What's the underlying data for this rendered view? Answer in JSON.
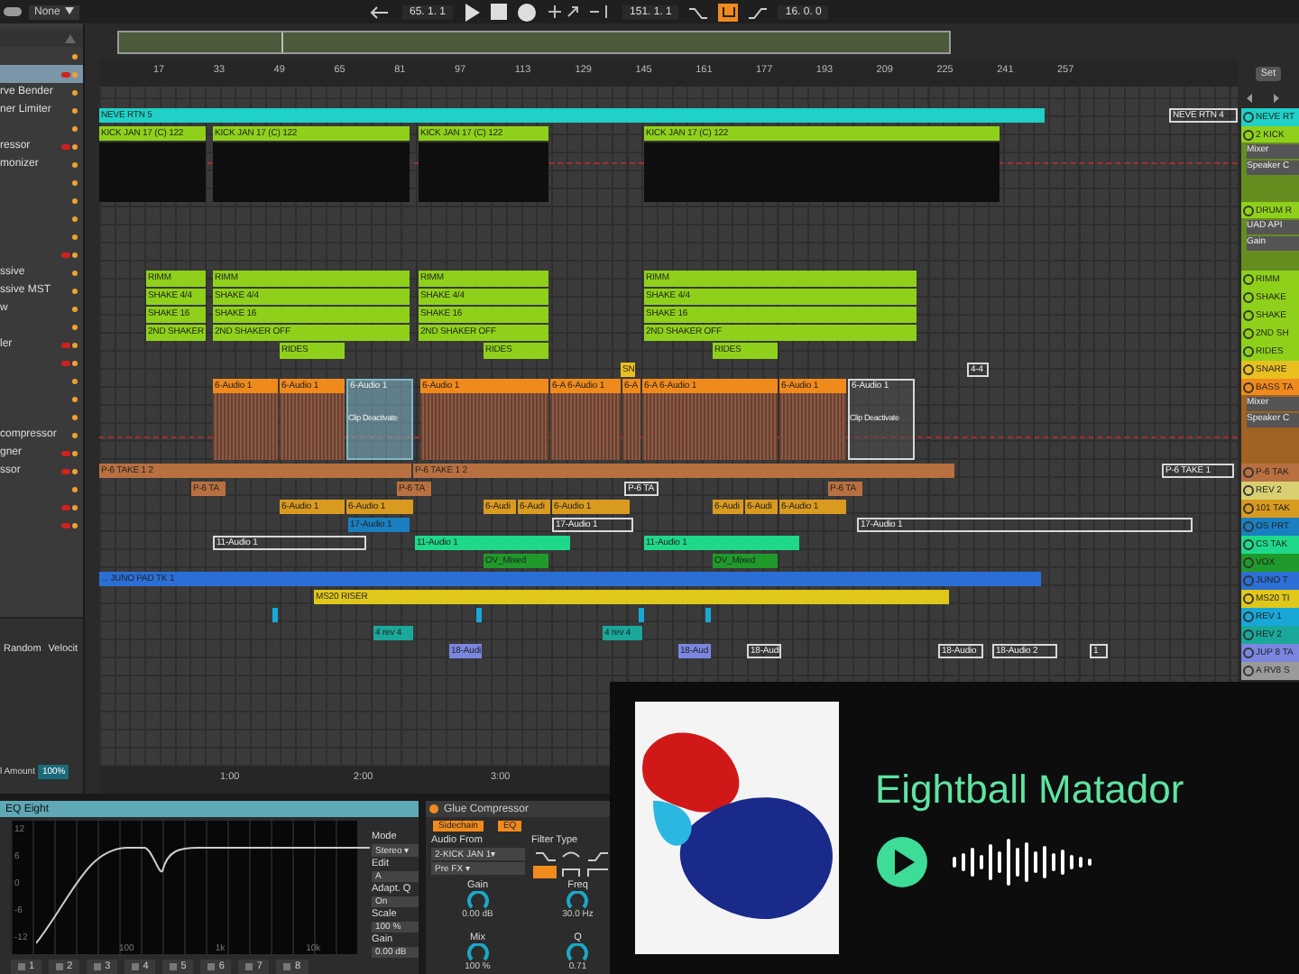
{
  "toolbar": {
    "dropdown": "None",
    "position": "65. 1. 1",
    "loop_start": "151. 1. 1",
    "loop_length": "16. 0. 0",
    "loop_on": true
  },
  "ruler": {
    "bars": [
      "17",
      "33",
      "49",
      "65",
      "81",
      "97",
      "113",
      "129",
      "145",
      "161",
      "177",
      "193",
      "209",
      "225",
      "241",
      "257"
    ],
    "set_button": "Set"
  },
  "browser": {
    "items": [
      {
        "selected": false,
        "flagged": false
      },
      {
        "selected": true,
        "flagged": true
      },
      {
        "label": "rve Bender",
        "selected": false,
        "flagged": false
      },
      {
        "label": "ner Limiter",
        "selected": false,
        "flagged": false
      },
      {
        "selected": false,
        "flagged": false
      },
      {
        "label": "ressor",
        "selected": false,
        "flagged": true
      },
      {
        "label": "monizer",
        "selected": false,
        "flagged": false
      },
      {
        "selected": false,
        "flagged": false
      },
      {
        "selected": false,
        "flagged": false
      },
      {
        "selected": false,
        "flagged": false
      },
      {
        "selected": false,
        "flagged": false
      },
      {
        "selected": false,
        "flagged": true
      },
      {
        "label": "ssive",
        "selected": false,
        "flagged": false
      },
      {
        "label": "ssive MST",
        "selected": false,
        "flagged": false
      },
      {
        "label": "w",
        "selected": false,
        "flagged": false
      },
      {
        "selected": false,
        "flagged": false
      },
      {
        "label": "ler",
        "selected": false,
        "flagged": true
      },
      {
        "selected": false,
        "flagged": true
      },
      {
        "selected": false,
        "flagged": false
      },
      {
        "selected": false,
        "flagged": false
      },
      {
        "selected": false,
        "flagged": false
      },
      {
        "label": "compressor",
        "selected": false,
        "flagged": false
      },
      {
        "label": "gner",
        "selected": false,
        "flagged": true
      },
      {
        "label": "ssor",
        "selected": false,
        "flagged": true
      },
      {
        "selected": false,
        "flagged": false
      },
      {
        "selected": false,
        "flagged": true
      },
      {
        "selected": false,
        "flagged": true
      }
    ],
    "columns": [
      "Random",
      "Velocit"
    ],
    "amount_label": "l Amount",
    "amount_value": "100%"
  },
  "lanes": [
    {
      "clips": [
        {
          "label": "NEVE RTN 5",
          "color": "#1fd1c6",
          "kind": "filled"
        },
        {
          "label": "NEVE RTN 4",
          "color": "#d8d8d8",
          "kind": "outline"
        }
      ]
    },
    {
      "clips": [
        {
          "label": "KICK JAN 17 (C) 122",
          "color": "#8fd11a",
          "kind": "midi"
        },
        {
          "label": "KICK JAN 17 (C) 122",
          "color": "#8fd11a",
          "kind": "midi"
        },
        {
          "label": "KICK JAN 17 (C) 122",
          "color": "#8fd11a",
          "kind": "midi"
        },
        {
          "label": "KICK JAN 17 (C) 122",
          "color": "#8fd11a",
          "kind": "midi"
        }
      ]
    },
    {
      "clips": [
        {
          "label": "RIMM",
          "color": "#8fd11a",
          "kind": "filled"
        },
        {
          "label": "RIMM",
          "color": "#8fd11a",
          "kind": "filled"
        },
        {
          "label": "RIMM",
          "color": "#8fd11a",
          "kind": "filled"
        },
        {
          "label": "RIMM",
          "color": "#8fd11a",
          "kind": "filled"
        }
      ]
    },
    {
      "clips": [
        {
          "label": "SHAKE 4/4",
          "color": "#8fd11a",
          "kind": "filled"
        },
        {
          "label": "SHAKE 4/4",
          "color": "#8fd11a",
          "kind": "filled"
        },
        {
          "label": "SHAKE 4/4",
          "color": "#8fd11a",
          "kind": "filled"
        },
        {
          "label": "SHAKE 4/4",
          "color": "#8fd11a",
          "kind": "filled"
        }
      ]
    },
    {
      "clips": [
        {
          "label": "SHAKE 16",
          "color": "#8fd11a",
          "kind": "filled"
        },
        {
          "label": "SHAKE 16",
          "color": "#8fd11a",
          "kind": "filled"
        },
        {
          "label": "SHAKE 16",
          "color": "#8fd11a",
          "kind": "filled"
        },
        {
          "label": "SHAKE 16",
          "color": "#8fd11a",
          "kind": "filled"
        }
      ]
    },
    {
      "clips": [
        {
          "label": "2ND SHAKER",
          "color": "#8fd11a",
          "kind": "filled"
        },
        {
          "label": "2ND SHAKER OFF",
          "color": "#8fd11a",
          "kind": "filled"
        },
        {
          "label": "2ND SHAKER OFF",
          "color": "#8fd11a",
          "kind": "filled"
        },
        {
          "label": "2ND SHAKER OFF",
          "color": "#8fd11a",
          "kind": "filled"
        }
      ]
    },
    {
      "clips": [
        {
          "label": "RIDES",
          "color": "#8fd11a",
          "kind": "filled"
        },
        {
          "label": "RIDES",
          "color": "#8fd11a",
          "kind": "filled"
        },
        {
          "label": "RIDES",
          "color": "#8fd11a",
          "kind": "filled"
        }
      ]
    },
    {
      "clips": [
        {
          "label": "SN",
          "color": "#e8c020",
          "kind": "filled"
        },
        {
          "label": "4-4",
          "color": "#d8d8d8",
          "kind": "outline"
        }
      ]
    },
    {
      "clips": [
        {
          "label": "6-Audio 1",
          "color": "#f08a1c",
          "kind": "audio"
        },
        {
          "label": "6-Audio 1",
          "color": "#f08a1c",
          "kind": "audio"
        },
        {
          "label": "6-Audio 1",
          "color": "#7fb8c8",
          "kind": "deactivated",
          "note": "Clip Deactivate"
        },
        {
          "label": "6-Audio 1",
          "color": "#f08a1c",
          "kind": "audio"
        },
        {
          "label": "6-A 6-Audio 1",
          "color": "#f08a1c",
          "kind": "audio"
        },
        {
          "label": "6-A",
          "color": "#f08a1c",
          "kind": "audio"
        },
        {
          "label": "6-A 6-Audio 1",
          "color": "#f08a1c",
          "kind": "audio"
        },
        {
          "label": "6-Audio 1",
          "color": "#f08a1c",
          "kind": "audio"
        },
        {
          "label": "6-Audio 1",
          "color": "#d8d8d8",
          "kind": "deactivated",
          "note": "Clip Deactivate"
        }
      ]
    },
    {
      "clips": [
        {
          "label": "P-6 TAKE 1 2",
          "color": "#b87040",
          "kind": "filled"
        },
        {
          "label": "P-6 TAKE 1 2",
          "color": "#b87040",
          "kind": "filled"
        },
        {
          "label": "P-6 TAKE 1",
          "color": "#d8d8d8",
          "kind": "outline"
        }
      ]
    },
    {
      "clips": [
        {
          "label": "P-6 TA",
          "color": "#b87040",
          "kind": "filled"
        },
        {
          "label": "P-6 TA",
          "color": "#b87040",
          "kind": "filled"
        },
        {
          "label": "P-6 TA",
          "color": "#d8d8d8",
          "kind": "outline"
        },
        {
          "label": "P-6 TA",
          "color": "#b87040",
          "kind": "filled"
        }
      ]
    },
    {
      "clips": [
        {
          "label": "6-Audio 1",
          "color": "#d99a20",
          "kind": "filled"
        },
        {
          "label": "6-Audio 1",
          "color": "#d99a20",
          "kind": "filled"
        },
        {
          "label": "6-Audi",
          "color": "#d99a20",
          "kind": "filled"
        },
        {
          "label": "6-Audi",
          "color": "#d99a20",
          "kind": "filled"
        },
        {
          "label": "6-Audio 1",
          "color": "#d99a20",
          "kind": "filled"
        },
        {
          "label": "6-Audi",
          "color": "#d99a20",
          "kind": "filled"
        },
        {
          "label": "6-Audi",
          "color": "#d99a20",
          "kind": "filled"
        },
        {
          "label": "6-Audio 1",
          "color": "#d99a20",
          "kind": "filled"
        }
      ]
    },
    {
      "clips": [
        {
          "label": "17-Audio 1",
          "color": "#1a7fc0",
          "kind": "filled"
        },
        {
          "label": "17-Audio 1",
          "color": "#d8d8d8",
          "kind": "outline"
        },
        {
          "label": "17-Audio 1",
          "color": "#d8d8d8",
          "kind": "outline"
        }
      ]
    },
    {
      "clips": [
        {
          "label": "11-Audio 1",
          "color": "#d8d8d8",
          "kind": "outline"
        },
        {
          "label": "11-Audio 1",
          "color": "#1fd98a",
          "kind": "filled"
        },
        {
          "label": "11-Audio 1",
          "color": "#1fd98a",
          "kind": "filled"
        }
      ]
    },
    {
      "clips": [
        {
          "label": "OV_Mixed",
          "color": "#1f9a2a",
          "kind": "filled"
        },
        {
          "label": "OV_Mixed",
          "color": "#1f9a2a",
          "kind": "filled"
        }
      ]
    },
    {
      "clips": [
        {
          "label": "... JUNO PAD TK 1",
          "color": "#2b6fd6",
          "kind": "filled"
        }
      ]
    },
    {
      "clips": [
        {
          "label": "MS20 RISER",
          "color": "#e0c81a",
          "kind": "filled"
        }
      ]
    },
    {
      "clips": [
        {
          "color": "#18a8d8",
          "kind": "filled"
        },
        {
          "color": "#18a8d8",
          "kind": "filled"
        },
        {
          "color": "#18a8d8",
          "kind": "filled"
        },
        {
          "color": "#18a8d8",
          "kind": "filled"
        }
      ]
    },
    {
      "clips": [
        {
          "label": "4 rev 4",
          "color": "#1aa89a",
          "kind": "filled"
        },
        {
          "label": "4 rev 4",
          "color": "#1aa89a",
          "kind": "filled"
        }
      ]
    },
    {
      "clips": [
        {
          "label": "18-Audi",
          "color": "#7a86e0",
          "kind": "filled"
        },
        {
          "label": "18-Aud",
          "color": "#7a86e0",
          "kind": "filled"
        },
        {
          "label": "18-Audi",
          "color": "#d8d8d8",
          "kind": "outline"
        },
        {
          "label": "18-Audio",
          "color": "#d8d8d8",
          "kind": "outline"
        },
        {
          "label": "18-Audio 2",
          "color": "#d8d8d8",
          "kind": "outline"
        },
        {
          "label": "1",
          "color": "#d8d8d8",
          "kind": "outline"
        }
      ]
    }
  ],
  "time_ruler": [
    "1:00",
    "2:00",
    "3:00"
  ],
  "tracks": [
    {
      "label": "NEVE RT",
      "color": "#1fd1c6"
    },
    {
      "label": "2 KICK",
      "color": "#8fd11a",
      "children": [
        {
          "label": "Mixer"
        },
        {
          "label": "Speaker C"
        }
      ]
    },
    {
      "label": "DRUM R",
      "color": "#8fd11a",
      "children": [
        {
          "label": "UAD API"
        },
        {
          "label": "Gain"
        }
      ]
    },
    {
      "label": "RIMM",
      "color": "#8fd11a"
    },
    {
      "label": "SHAKE",
      "color": "#8fd11a"
    },
    {
      "label": "SHAKE",
      "color": "#8fd11a"
    },
    {
      "label": "2ND SH",
      "color": "#8fd11a"
    },
    {
      "label": "RIDES",
      "color": "#8fd11a"
    },
    {
      "label": "SNARE",
      "color": "#e8c020"
    },
    {
      "label": "BASS TA",
      "color": "#f08a1c",
      "children": [
        {
          "label": "Mixer"
        },
        {
          "label": "Speaker C"
        }
      ]
    },
    {
      "label": "P-6 TAK",
      "color": "#b87040"
    },
    {
      "label": "REV 2",
      "color": "#d8d070"
    },
    {
      "label": "101 TAK",
      "color": "#d99a20"
    },
    {
      "label": "OS PRT",
      "color": "#1a7fc0"
    },
    {
      "label": "CS TAK",
      "color": "#1fd98a"
    },
    {
      "label": "VOX",
      "color": "#1f9a2a"
    },
    {
      "label": "JUNO T",
      "color": "#2b6fd6"
    },
    {
      "label": "MS20 TI",
      "color": "#e0c81a"
    },
    {
      "label": "REV 1",
      "color": "#18a8d8"
    },
    {
      "label": "REV 2",
      "color": "#1aa89a"
    },
    {
      "label": "JUP 8 TA",
      "color": "#7a86e0"
    },
    {
      "label": "A RV8 S",
      "color": "#9a9a9a"
    }
  ],
  "eq": {
    "title": "EQ Eight",
    "db_ticks": [
      "12",
      "6",
      "0",
      "-6",
      "-12"
    ],
    "freq_ticks": [
      "100",
      "1k",
      "10k"
    ],
    "mode_label": "Mode",
    "mode": "Stereo ▾",
    "edit_label": "Edit",
    "edit": "A",
    "adapt_label": "Adapt. Q",
    "adapt": "On",
    "scale_label": "Scale",
    "scale": "100 %",
    "gain_label": "Gain",
    "gain": "0.00 dB",
    "bands": [
      "1",
      "2",
      "3",
      "4",
      "5",
      "6",
      "7",
      "8"
    ]
  },
  "compressor": {
    "title": "Glue Compressor",
    "sidechain": "Sidechain",
    "eq": "EQ",
    "audio_from_label": "Audio From",
    "audio_from": "2-KICK JAN 1▾",
    "tap": "Pre FX ▾",
    "filter_label": "Filter Type",
    "knobs": [
      {
        "label": "Gain",
        "value": "0.00 dB"
      },
      {
        "label": "Freq",
        "value": "30.0 Hz"
      },
      {
        "label": "Mix",
        "value": "100 %"
      },
      {
        "label": "Q",
        "value": "0.71"
      }
    ]
  },
  "now_playing": {
    "title": "Eightball Matador"
  }
}
